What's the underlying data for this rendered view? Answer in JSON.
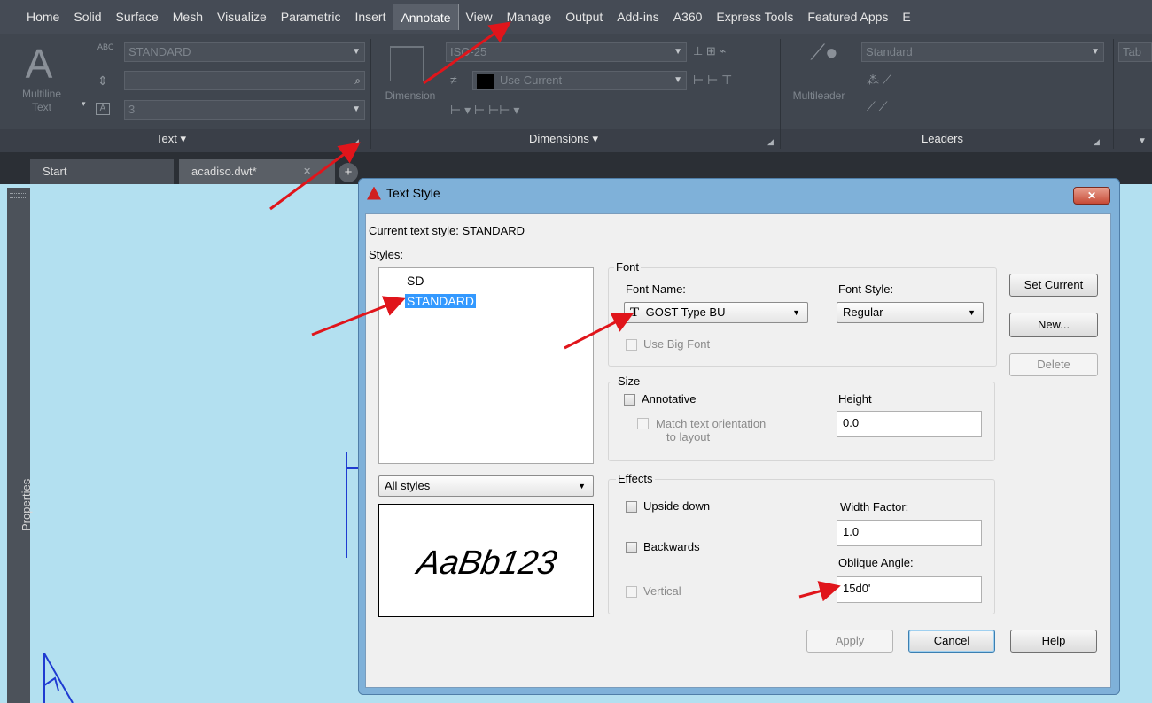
{
  "ribbon": {
    "tabs": [
      "Home",
      "Solid",
      "Surface",
      "Mesh",
      "Visualize",
      "Parametric",
      "Insert",
      "Annotate",
      "View",
      "Manage",
      "Output",
      "Add-ins",
      "A360",
      "Express Tools",
      "Featured Apps",
      "E"
    ],
    "active_tab": "Annotate",
    "text_panel": {
      "title": "Text ▾",
      "multiline_text_label": "Multiline\nText",
      "style_combo": "STANDARD",
      "height_combo": "3"
    },
    "dimensions_panel": {
      "title": "Dimensions ▾",
      "dimension_label": "Dimension",
      "dimstyle_combo": "ISO-25",
      "layer_combo": "Use Current"
    },
    "leaders_panel": {
      "title": "Leaders",
      "multileader_label": "Multileader",
      "style_combo": "Standard"
    },
    "truncated_combo": "Tab"
  },
  "document_tabs": {
    "start": "Start",
    "active": "acadiso.dwt*",
    "close_glyph": "✕",
    "new_glyph": "+"
  },
  "properties_palette": {
    "label": "Properties"
  },
  "dialog": {
    "title": "Text Style",
    "close_glyph": "✕",
    "current_style_label": "Current text style:  STANDARD",
    "styles_label": "Styles:",
    "styles": [
      "SD",
      "STANDARD"
    ],
    "selected_style": "STANDARD",
    "filter_value": "All styles",
    "preview_text": "AaBb123",
    "font": {
      "group_label": "Font",
      "font_name_label": "Font Name:",
      "font_name_value": "GOST Type BU",
      "font_icon_glyph": "T",
      "font_style_label": "Font Style:",
      "font_style_value": "Regular",
      "use_big_font_label": "Use Big Font"
    },
    "size": {
      "group_label": "Size",
      "annotative_label": "Annotative",
      "match_orientation_label": "Match text orientation",
      "match_orientation_label2": "to layout",
      "height_label": "Height",
      "height_value": "0.0"
    },
    "effects": {
      "group_label": "Effects",
      "upside_down_label": "Upside down",
      "backwards_label": "Backwards",
      "vertical_label": "Vertical",
      "width_factor_label": "Width Factor:",
      "width_factor_value": "1.0",
      "oblique_angle_label": "Oblique Angle:",
      "oblique_angle_value": "15d0'"
    },
    "buttons": {
      "set_current": "Set Current",
      "new": "New...",
      "delete": "Delete",
      "apply": "Apply",
      "cancel": "Cancel",
      "help": "Help"
    }
  },
  "colors": {
    "ribbon_bg": "#40464f",
    "drawing_bg": "#b3e0f0",
    "selection": "#3399ff",
    "annotation_arrow": "#e0151b"
  }
}
